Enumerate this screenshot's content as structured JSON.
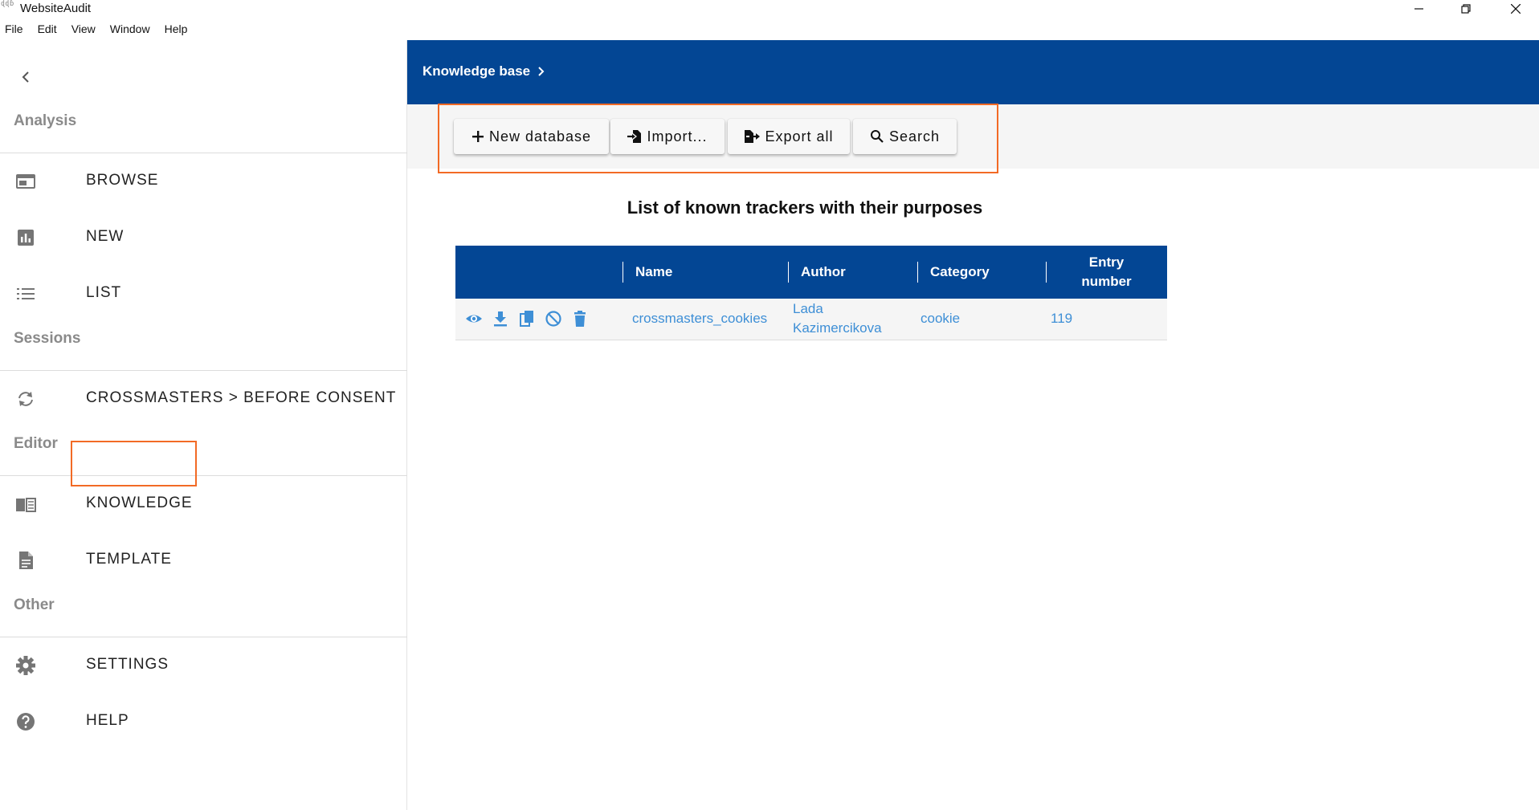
{
  "window": {
    "title": "WebsiteAudit",
    "icon_text": "ɖɖɓ"
  },
  "menu": [
    "File",
    "Edit",
    "View",
    "Window",
    "Help"
  ],
  "sidebar": {
    "sections": {
      "analysis": "Analysis",
      "sessions": "Sessions",
      "editor": "Editor",
      "other": "Other"
    },
    "items": {
      "browse": "BROWSE",
      "new": "NEW",
      "list": "LIST",
      "session": "CROSSMASTERS > BEFORE CONSENT",
      "knowledge": "KNOWLEDGE",
      "template": "TEMPLATE",
      "settings": "SETTINGS",
      "help": "HELP"
    }
  },
  "header": {
    "breadcrumb": "Knowledge base"
  },
  "toolbar": {
    "new_database": "New database",
    "import": "Import...",
    "export_all": "Export all",
    "search": "Search"
  },
  "main": {
    "title": "List of known trackers with their purposes",
    "table": {
      "headers": {
        "name": "Name",
        "author": "Author",
        "category": "Category",
        "entry_number_line1": "Entry",
        "entry_number_line2": "number"
      },
      "rows": [
        {
          "name": "crossmasters_cookies",
          "author_line1": "Lada",
          "author_line2": "Kazimercikova",
          "category": "cookie",
          "entry_number": "119"
        }
      ]
    }
  },
  "colors": {
    "brand": "#034694",
    "highlight": "#f26a25",
    "link": "#3e8fd6"
  }
}
